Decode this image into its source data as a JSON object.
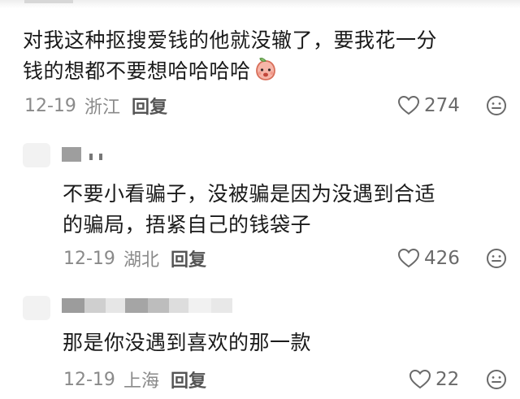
{
  "comment_main": {
    "line1": "对我这种抠搜爱钱的他就没辙了，要我花一分",
    "line2": "钱的想都不要想哈哈哈哈",
    "emoji": "peach-face-emoji",
    "date": "12-19",
    "location": "浙江",
    "reply_label": "回复",
    "likes": "274"
  },
  "reply1": {
    "line1": "不要小看骗子，没被骗是因为没遇到合适",
    "line2": "的骗局，捂紧自己的钱袋子",
    "date": "12-19",
    "location": "湖北",
    "reply_label": "回复",
    "likes": "426"
  },
  "reply2": {
    "line1": "那是你没遇到喜欢的那一款",
    "date": "12-19",
    "location": "上海",
    "reply_label": "回复",
    "likes": "22"
  },
  "colors": {
    "text": "#1a1a1a",
    "meta": "#8a8a8a",
    "reply": "#555555",
    "icon": "#6a6a6a"
  }
}
